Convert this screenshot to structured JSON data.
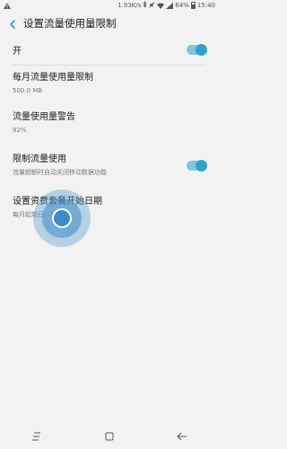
{
  "status_bar": {
    "speed": "1.93K/s",
    "battery": "64%",
    "time": "15:40"
  },
  "header": {
    "title": "设置流量使用量限制"
  },
  "master": {
    "label": "开",
    "on": true
  },
  "items": [
    {
      "title": "每月流量使用量限制",
      "subtitle": "500.0 MB"
    },
    {
      "title": "流量使用量警告",
      "subtitle": "92%"
    },
    {
      "title": "限制流量使用",
      "subtitle": "流量超额时自动关闭移动数据功能",
      "on": true
    },
    {
      "title": "设置资费套餐开始日期",
      "subtitle": "每月起始日：1"
    }
  ],
  "colors": {
    "accent": "#2da4cc",
    "track": "#7fc7df",
    "touch": "#3d8cc9"
  }
}
